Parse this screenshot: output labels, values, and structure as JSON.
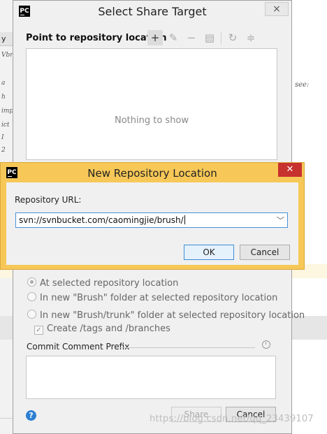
{
  "background": {
    "tab_text": "y",
    "code_lines": [
      "Vbr",
      "",
      "",
      "a",
      "h",
      "imp",
      "ict",
      "I",
      "2"
    ],
    "side_text": "see:"
  },
  "main_dialog": {
    "title": "Select Share Target",
    "close_glyph": "×",
    "logo_text": "PC",
    "section_label": "Point to repository location",
    "toolbar": {
      "add_glyph": "+",
      "edit_glyph": "✎",
      "remove_glyph": "−",
      "copy_glyph": "▤",
      "refresh_glyph": "↻",
      "collapse_glyph": "≑"
    },
    "tree_empty_text": "Nothing to show",
    "options": [
      {
        "label": "At selected repository location",
        "checked": true
      },
      {
        "label": "In new \"Brush\" folder at selected repository location",
        "checked": false
      },
      {
        "label": "In new \"Brush/trunk\" folder at selected repository location",
        "checked": false
      }
    ],
    "create_tags_label": "Create /tags and /branches",
    "create_tags_checked": true,
    "commit_prefix_label": "Commit Comment Prefix",
    "help_glyph": "?",
    "share_button": "Share",
    "cancel_button": "Cancel"
  },
  "repo_dialog": {
    "title": "New Repository Location",
    "logo_text": "PC",
    "close_glyph": "✕",
    "url_label": "Repository URL:",
    "url_value": "svn://svnbucket.com/caomingjie/brush/",
    "dropdown_glyph": "﹀",
    "ok_button": "OK",
    "cancel_button": "Cancel"
  },
  "watermark": "https://blog.csdn.net/qq_23439107",
  "colors": {
    "accent_border": "#f7c857",
    "close_red": "#c7312e",
    "help_blue": "#2d7fd3"
  }
}
